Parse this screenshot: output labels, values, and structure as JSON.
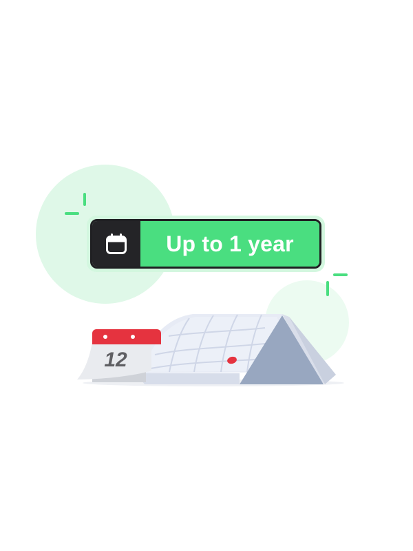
{
  "badge": {
    "label": "Up to 1 year",
    "icon": "calendar-icon"
  },
  "calendar": {
    "page_number": "12",
    "icon": "tear-off-calendar"
  },
  "colors": {
    "accent_green": "#4ade80",
    "light_green": "#dff8e8",
    "dark": "#242427",
    "calendar_red": "#e5333f",
    "calendar_paper": "#e8ecf5",
    "calendar_shadow": "#98a7c0"
  }
}
